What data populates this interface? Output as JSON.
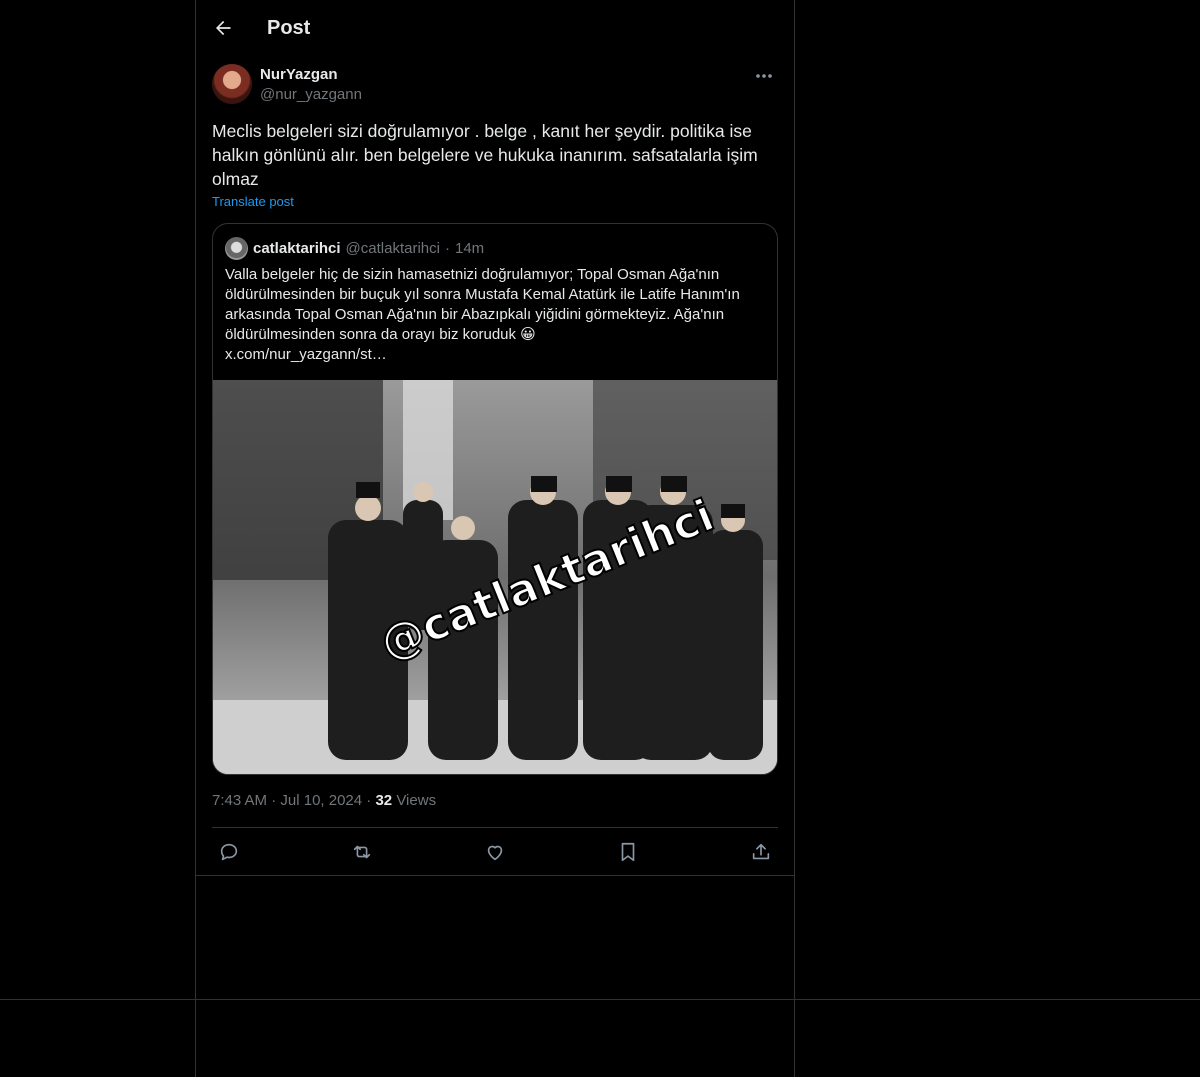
{
  "header": {
    "title": "Post"
  },
  "post": {
    "display_name": "NurYazgan",
    "handle": "@nur_yazgann",
    "text": "Meclis belgeleri sizi doğrulamıyor . belge , kanıt her şeydir. politika ise halkın gönlünü alır. ben belgelere ve hukuka inanırım. safsatalarla işim olmaz",
    "translate_label": "Translate post",
    "time": "7:43 AM",
    "date": "Jul 10, 2024",
    "views_count": "32",
    "views_label": "Views",
    "dot": "·"
  },
  "quote": {
    "display_name": "catlaktarihci",
    "handle": "@catlaktarihci",
    "dot": "·",
    "time": "14m",
    "text": "Valla belgeler hiç de sizin hamasetnizi doğrulamıyor; Topal Osman Ağa'nın öldürülmesinden bir buçuk yıl sonra Mustafa Kemal Atatürk ile Latife Hanım'ın arkasında Topal Osman Ağa'nın bir Abazıpkalı yiğidini görmekteyiz. Ağa'nın öldürülmesinden sonra da orayı biz koruduk 😀\nx.com/nur_yazgann/st…",
    "image_watermark": "@catlaktarihci"
  },
  "icons": {
    "back": "arrow-left-icon",
    "more": "more-dots-icon",
    "reply": "reply-icon",
    "repost": "repost-icon",
    "like": "heart-icon",
    "bookmark": "bookmark-icon",
    "share": "share-icon"
  },
  "colors": {
    "background": "#000000",
    "text": "#e7e9ea",
    "muted": "#71767b",
    "accent": "#1d9bf0",
    "border": "#2f3336"
  }
}
